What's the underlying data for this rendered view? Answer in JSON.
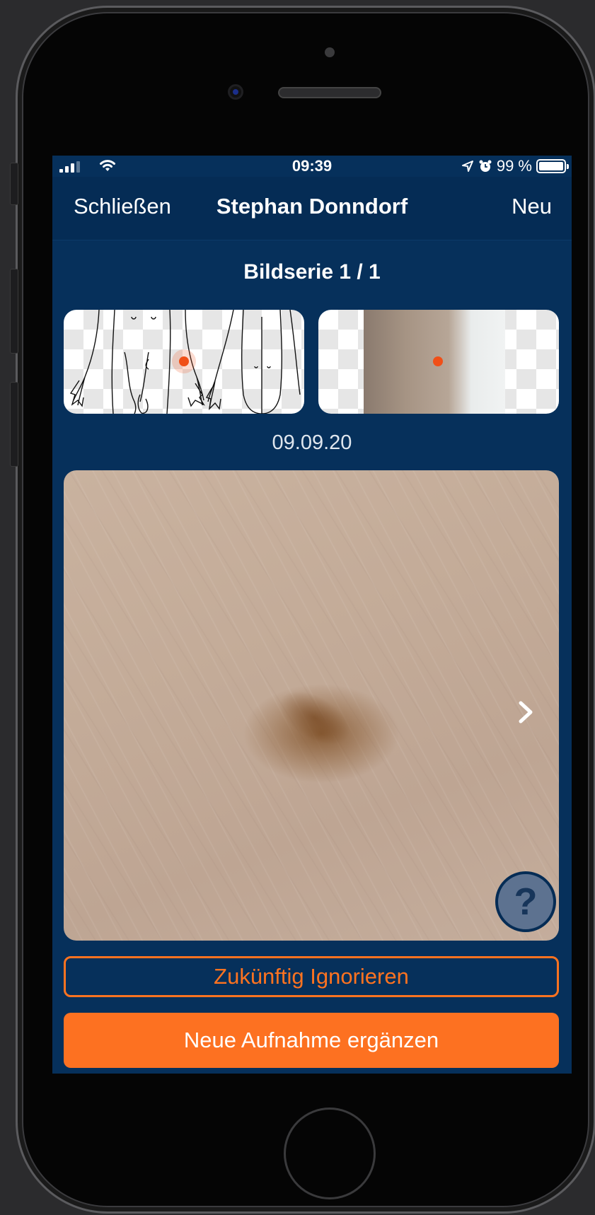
{
  "statusbar": {
    "time": "09:39",
    "battery_text": "99 %",
    "battery_level": 0.99,
    "icons": [
      "cellular-signal-icon",
      "wifi-icon",
      "location-arrow-icon",
      "alarm-icon",
      "battery-icon"
    ]
  },
  "navbar": {
    "left_label": "Schließen",
    "title": "Stephan Donndorf",
    "right_label": "Neu"
  },
  "series": {
    "title": "Bildserie 1 / 1",
    "date": "09.09.20"
  },
  "buttons": {
    "ignore_label": "Zukünftig Ignorieren",
    "add_label": "Neue Aufnahme ergänzen",
    "help_label": "?"
  },
  "colors": {
    "background": "#06305b",
    "accent": "#fd7121",
    "marker": "#f04f17"
  }
}
